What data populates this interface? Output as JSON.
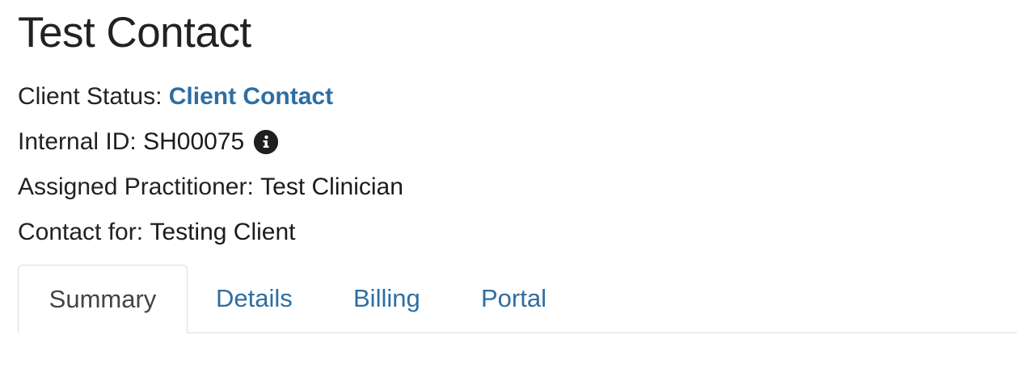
{
  "page": {
    "title": "Test Contact"
  },
  "info": {
    "client_status_label": "Client Status: ",
    "client_status_value": "Client Contact",
    "internal_id_label": "Internal ID: ",
    "internal_id_value": "SH00075",
    "assigned_practitioner_label": "Assigned Practitioner: ",
    "assigned_practitioner_value": "Test Clinician",
    "contact_for_label": "Contact for: ",
    "contact_for_value": "Testing Client"
  },
  "icons": {
    "internal_id_info": "info-icon"
  },
  "tabs": [
    {
      "label": "Summary",
      "active": true
    },
    {
      "label": "Details",
      "active": false
    },
    {
      "label": "Billing",
      "active": false
    },
    {
      "label": "Portal",
      "active": false
    }
  ],
  "colors": {
    "link": "#2e6ea2",
    "text": "#222222",
    "active_tab_text": "#444444",
    "border": "#dddddd"
  }
}
